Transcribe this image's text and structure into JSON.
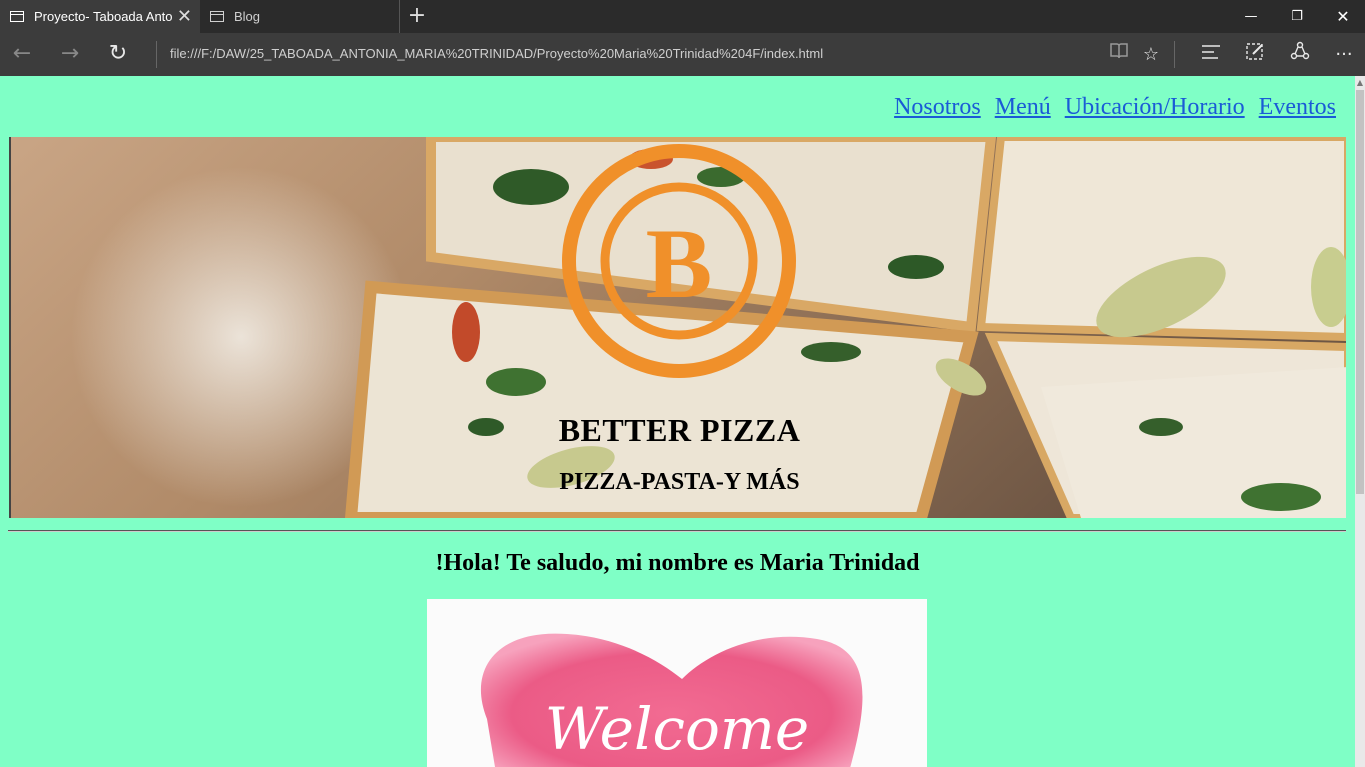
{
  "browser": {
    "tabs": [
      {
        "title": "Proyecto- Taboada Anto",
        "active": true
      },
      {
        "title": "Blog",
        "active": false
      }
    ],
    "url": "file:///F:/DAW/25_TABOADA_ANTONIA_MARIA%20TRINIDAD/Proyecto%20Maria%20Trinidad%204F/index.html",
    "icons": [
      "back-icon",
      "forward-icon",
      "refresh-icon",
      "reading-view-icon",
      "favorite-star-icon",
      "hub-icon",
      "web-note-icon",
      "share-icon",
      "more-icon",
      "minimize-icon",
      "restore-icon",
      "close-icon",
      "new-tab-icon"
    ]
  },
  "nav": {
    "items": [
      "Nosotros",
      "Menú",
      "Ubicación/Horario",
      "Eventos"
    ]
  },
  "banner": {
    "logo_letter": "B",
    "title": "BETTER PIZZA",
    "subtitle": "PIZZA-PASTA-Y MÁS",
    "accent_color": "#f0902a"
  },
  "main": {
    "greeting": "!Hola! Te saludo, mi nombre es Maria Trinidad",
    "welcome_image_text": "Welcome"
  },
  "colors": {
    "page_background": "#7fffc6",
    "link": "#1a5bd6"
  }
}
